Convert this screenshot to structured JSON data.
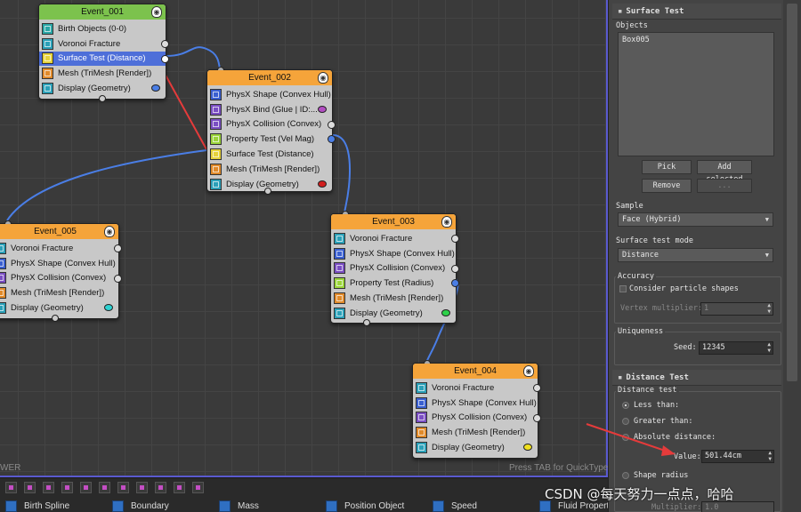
{
  "canvas": {
    "hint_left": "WER",
    "hint_right": "Press TAB for QuickType"
  },
  "nodes": {
    "event_001": {
      "title": "Event_001",
      "operators": [
        {
          "label": "Birth Objects (0-0)",
          "icon": "birth-objects-icon"
        },
        {
          "label": "Voronoi Fracture",
          "icon": "voronoi-fracture-icon"
        },
        {
          "label": "Surface Test (Distance)",
          "icon": "surface-test-icon",
          "selected": true
        },
        {
          "label": "Mesh (TriMesh [Render])",
          "icon": "mesh-icon"
        },
        {
          "label": "Display (Geometry)",
          "icon": "display-icon",
          "color": "#4a7ee6"
        }
      ]
    },
    "event_002": {
      "title": "Event_002",
      "operators": [
        {
          "label": "PhysX Shape (Convex Hull)",
          "icon": "physx-shape-icon"
        },
        {
          "label": "PhysX Bind (Glue | ID:...",
          "icon": "physx-bind-icon",
          "color": "#b24ec2"
        },
        {
          "label": "PhysX Collision (Convex)",
          "icon": "physx-collision-icon"
        },
        {
          "label": "Property Test (Vel Mag)",
          "icon": "property-test-icon"
        },
        {
          "label": "Surface Test (Distance)",
          "icon": "surface-test-icon"
        },
        {
          "label": "Mesh (TriMesh [Render])",
          "icon": "mesh-icon"
        },
        {
          "label": "Display (Geometry)",
          "icon": "display-icon",
          "color": "#d21e1e"
        }
      ]
    },
    "event_003": {
      "title": "Event_003",
      "operators": [
        {
          "label": "Voronoi Fracture",
          "icon": "voronoi-fracture-icon"
        },
        {
          "label": "PhysX Shape (Convex Hull)",
          "icon": "physx-shape-icon"
        },
        {
          "label": "PhysX Collision (Convex)",
          "icon": "physx-collision-icon"
        },
        {
          "label": "Property Test (Radius)",
          "icon": "property-test-icon"
        },
        {
          "label": "Mesh (TriMesh [Render])",
          "icon": "mesh-icon"
        },
        {
          "label": "Display (Geometry)",
          "icon": "display-icon",
          "color": "#2ed24a"
        }
      ]
    },
    "event_004": {
      "title": "Event_004",
      "operators": [
        {
          "label": "Voronoi Fracture",
          "icon": "voronoi-fracture-icon"
        },
        {
          "label": "PhysX Shape (Convex Hull)",
          "icon": "physx-shape-icon"
        },
        {
          "label": "PhysX Collision (Convex)",
          "icon": "physx-collision-icon"
        },
        {
          "label": "Mesh (TriMesh [Render])",
          "icon": "mesh-icon"
        },
        {
          "label": "Display (Geometry)",
          "icon": "display-icon",
          "color": "#f0e020"
        }
      ]
    },
    "event_005": {
      "title": "Event_005",
      "operators": [
        {
          "label": "Voronoi Fracture",
          "icon": "voronoi-fracture-icon"
        },
        {
          "label": "PhysX Shape (Convex Hull)",
          "icon": "physx-shape-icon"
        },
        {
          "label": "PhysX Collision (Convex)",
          "icon": "physx-collision-icon"
        },
        {
          "label": "Mesh (TriMesh [Render])",
          "icon": "mesh-icon"
        },
        {
          "label": "Display (Geometry)",
          "icon": "display-icon",
          "color": "#2ed2d2"
        }
      ]
    }
  },
  "depot": {
    "items": [
      "Birth Spline",
      "Boundary",
      "Mass",
      "Position Object",
      "Speed",
      "Fluid Properti"
    ]
  },
  "panel": {
    "surface_test": {
      "title": "Surface Test",
      "objects_label": "Objects",
      "objects": [
        "Box005"
      ],
      "pick_label": "Pick",
      "add_selected_label": "Add selected",
      "remove_label": "Remove",
      "ellipsis_label": "...",
      "sample_label": "Sample",
      "sample_value": "Face (Hybrid)",
      "mode_label": "Surface test mode",
      "mode_value": "Distance",
      "accuracy_label": "Accuracy",
      "consider_label": "Consider particle shapes",
      "vertex_mult_label": "Vertex multiplier:",
      "vertex_mult_value": "1",
      "uniqueness_label": "Uniqueness",
      "seed_label": "Seed:",
      "seed_value": "12345"
    },
    "distance_test": {
      "title": "Distance Test",
      "group_label": "Distance test",
      "less_than_label": "Less than:",
      "greater_than_label": "Greater than:",
      "absolute_label": "Absolute distance:",
      "value_label": "Value:",
      "value": "501.44cm",
      "shape_radius_label": "Shape radius",
      "multiplier_label": "Multiplier:",
      "multiplier_value": "1.0"
    }
  },
  "watermark": "CSDN @每天努力一点点，哈哈",
  "colors": {
    "event_green": "#7cc24d",
    "event_orange": "#f5a43a",
    "wire_blue": "#4a7ee6",
    "selected_row": "#4e6fd9",
    "arrow_red": "#e53b3b"
  }
}
